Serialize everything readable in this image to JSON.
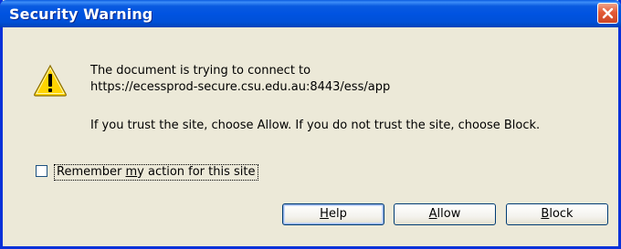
{
  "window": {
    "title": "Security Warning"
  },
  "message": {
    "line1": "The document is trying to connect to",
    "line2": "https://ecessprod-secure.csu.edu.au:8443/ess/app",
    "line3": "If you trust the site, choose Allow. If you do not trust the site, choose Block."
  },
  "checkbox": {
    "label_pre": "Remember ",
    "label_mnemonic": "m",
    "label_post": "y action for this site",
    "checked": false
  },
  "buttons": {
    "help": {
      "mnemonic": "H",
      "rest": "elp"
    },
    "allow": {
      "mnemonic": "A",
      "rest": "llow"
    },
    "block": {
      "mnemonic": "B",
      "rest": "lock"
    }
  },
  "icons": {
    "warning": "warning-icon",
    "close": "close-icon"
  },
  "colors": {
    "titlebar": "#0053e1",
    "close_button": "#e35a36",
    "dialog_background": "#ece9d8",
    "warning_yellow": "#ffd400"
  }
}
